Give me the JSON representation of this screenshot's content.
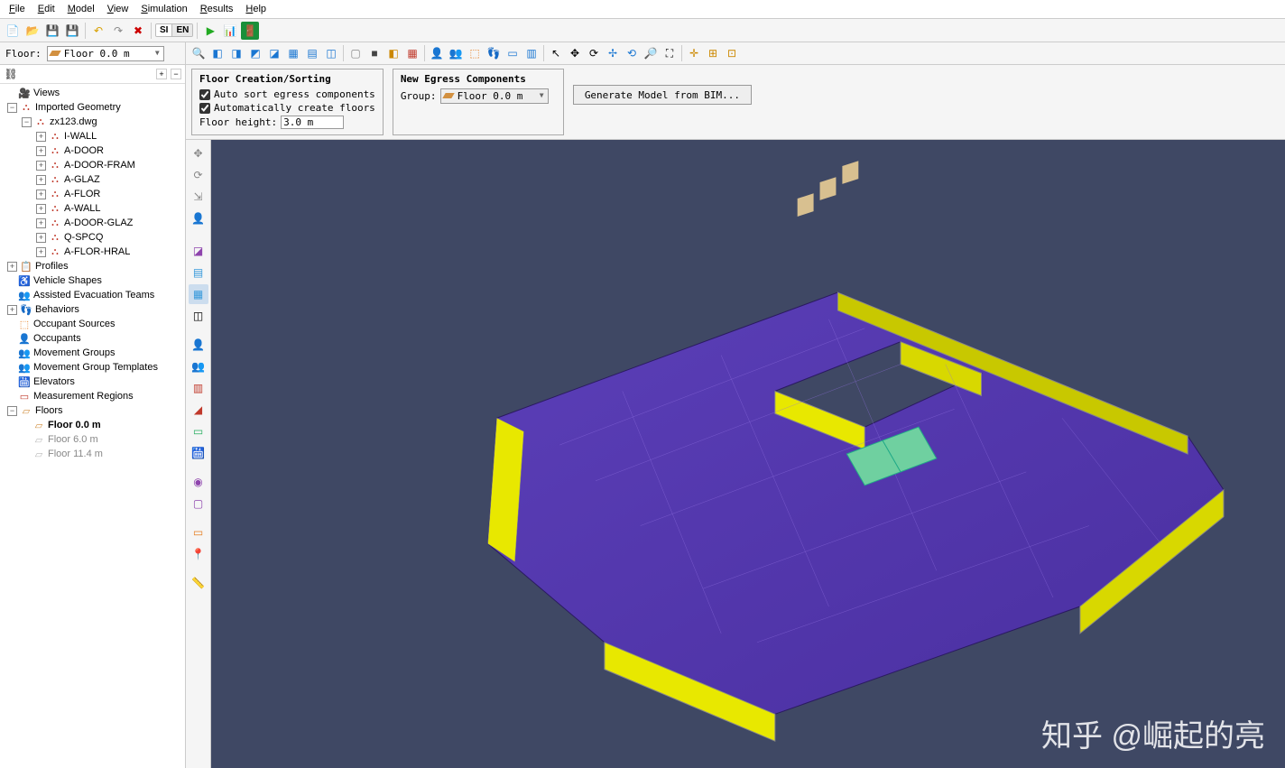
{
  "menu": [
    "File",
    "Edit",
    "Model",
    "View",
    "Simulation",
    "Results",
    "Help"
  ],
  "floor_label": "Floor:",
  "floor_selected": "Floor 0.0 m",
  "prop": {
    "floor_sort_title": "Floor Creation/Sorting",
    "auto_sort_label": "Auto sort egress components",
    "auto_create_label": "Automatically create floors",
    "floor_height_label": "Floor height:",
    "floor_height_value": "3.0 m",
    "egress_title": "New Egress Components",
    "group_label": "Group:",
    "group_value": "Floor 0.0 m",
    "bim_button": "Generate Model from BIM..."
  },
  "tree": {
    "views": "Views",
    "imported_geometry": "Imported Geometry",
    "dwg_file": "zx123.dwg",
    "layers": [
      "I-WALL",
      "A-DOOR",
      "A-DOOR-FRAM",
      "A-GLAZ",
      "A-FLOR",
      "A-WALL",
      "A-DOOR-GLAZ",
      "Q-SPCQ",
      "A-FLOR-HRAL"
    ],
    "profiles": "Profiles",
    "vehicle_shapes": "Vehicle Shapes",
    "assisted": "Assisted Evacuation Teams",
    "behaviors": "Behaviors",
    "occ_sources": "Occupant Sources",
    "occupants": "Occupants",
    "move_groups": "Movement Groups",
    "move_group_tpl": "Movement Group Templates",
    "elevators": "Elevators",
    "measure": "Measurement Regions",
    "floors": "Floors",
    "floor_list": [
      {
        "label": "Floor 0.0 m",
        "bold": true,
        "gray": false
      },
      {
        "label": "Floor 6.0 m",
        "bold": false,
        "gray": true
      },
      {
        "label": "Floor 11.4 m",
        "bold": false,
        "gray": true
      }
    ]
  },
  "watermark": "知乎 @崛起的亮"
}
